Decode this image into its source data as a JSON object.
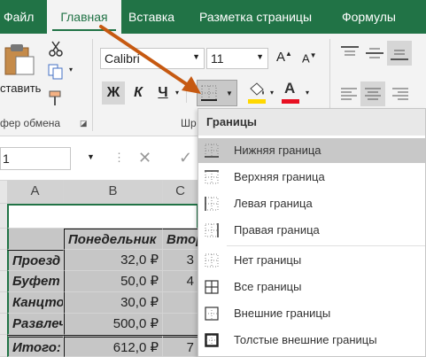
{
  "tabs": [
    "Файл",
    "Главная",
    "Вставка",
    "Разметка страницы",
    "Формулы"
  ],
  "ribbon": {
    "paste_label": "ставить",
    "clipboard_group": "фер обмена",
    "font_name": "Calibri",
    "font_size": "11",
    "bold": "Ж",
    "italic": "К",
    "underline": "Ч",
    "font_group": "Шр",
    "font_color": "#e81123",
    "fill_color": "#ffd800"
  },
  "formula_bar": {
    "name_box": "1"
  },
  "sheet": {
    "columns": [
      "A",
      "B",
      "C"
    ],
    "rows": [
      {
        "a": "",
        "b": "",
        "c": ""
      },
      {
        "a": "",
        "b": "Понедельник",
        "c": "Втор"
      },
      {
        "a": "Проезд",
        "b": "32,0 ₽",
        "c": "3"
      },
      {
        "a": "Буфет",
        "b": "50,0 ₽",
        "c": "4"
      },
      {
        "a": "Канцто",
        "b": "30,0 ₽",
        "c": ""
      },
      {
        "a": "Развлеч",
        "b": "500,0 ₽",
        "c": ""
      },
      {
        "a": "Итого:",
        "b": "612,0 ₽",
        "c": "7"
      }
    ]
  },
  "borders_menu": {
    "title": "Границы",
    "items": [
      {
        "label": "Нижняя граница",
        "icon": "bottom-border-icon"
      },
      {
        "label": "Верхняя граница",
        "icon": "top-border-icon"
      },
      {
        "label": "Левая граница",
        "icon": "left-border-icon"
      },
      {
        "label": "Правая граница",
        "icon": "right-border-icon"
      },
      {
        "label": "Нет границы",
        "icon": "no-border-icon"
      },
      {
        "label": "Все границы",
        "icon": "all-borders-icon"
      },
      {
        "label": "Внешние границы",
        "icon": "outside-borders-icon"
      },
      {
        "label": "Толстые внешние границы",
        "icon": "thick-outside-borders-icon"
      }
    ]
  },
  "colors": {
    "accent": "#217346",
    "arrow": "#c65911",
    "selection": "#c6c6c6"
  }
}
